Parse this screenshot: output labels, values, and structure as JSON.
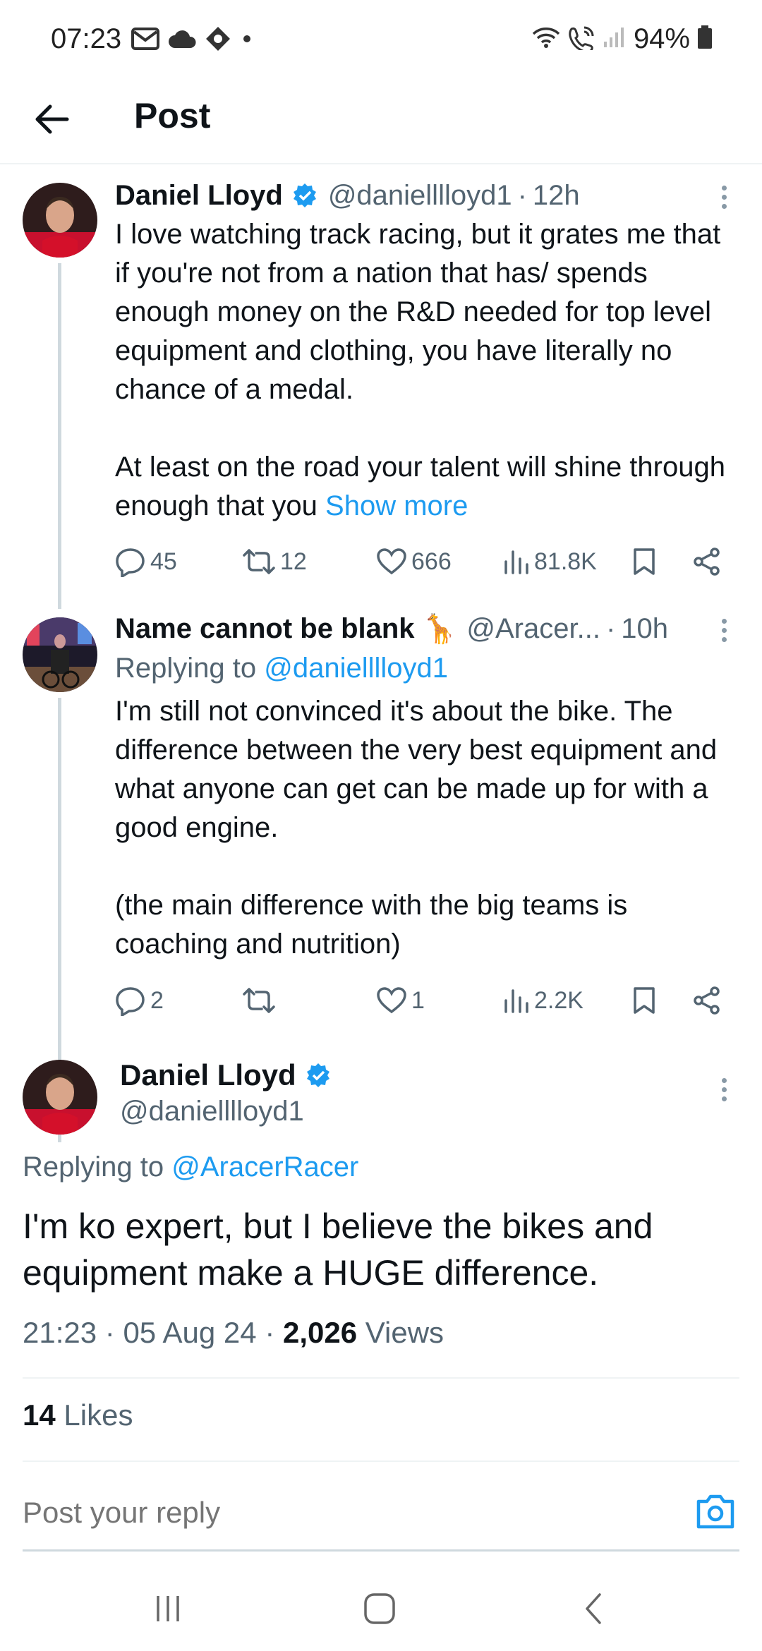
{
  "status_bar": {
    "time": "07:23",
    "battery": "94%",
    "left_icons": [
      "mail-icon",
      "cloud-icon",
      "vpn-icon",
      "notification-dot-icon"
    ],
    "right_icons": [
      "wifi-icon",
      "wifi-calling-icon",
      "signal-icon",
      "battery-icon"
    ]
  },
  "header": {
    "title": "Post",
    "back_icon": "back-arrow-icon"
  },
  "tweets": [
    {
      "name": "Daniel Lloyd",
      "verified": true,
      "handle": "@danielllloyd1",
      "separator": "·",
      "time": "12h",
      "text": "I love watching track racing, but it grates me that if you're not from a nation that has/ spends enough money on the R&D needed for top level equipment and clothing, you have literally no chance of a medal.\n\nAt least on the road your talent will shine through enough that you ",
      "show_more": "Show more",
      "actions": {
        "replies": "45",
        "reposts": "12",
        "likes": "666",
        "views": "81.8K"
      }
    },
    {
      "name": "Name cannot be blank",
      "emoji": "🦒",
      "handle": "@Aracer...",
      "separator": "·",
      "time": "10h",
      "replying_prefix": "Replying to ",
      "replying_to": "@danielllloyd1",
      "text": "I'm still not convinced it's about the bike. The difference between the very best equipment and what anyone can get can be made up for with a good engine.\n\n(the main difference with the big teams is coaching and nutrition)",
      "actions": {
        "replies": "2",
        "reposts": "",
        "likes": "1",
        "views": "2.2K"
      }
    }
  ],
  "focus_tweet": {
    "name": "Daniel Lloyd",
    "verified": true,
    "handle": "@danielllloyd1",
    "replying_prefix": "Replying to ",
    "replying_to": "@AracerRacer",
    "text": "I'm ko expert, but I believe the bikes and equipment make a HUGE difference.",
    "time": "21:23",
    "separator": "·",
    "date": "05 Aug 24",
    "views_count": "2,026",
    "views_label": "Views",
    "likes_count": "14",
    "likes_label": "Likes"
  },
  "reply_box": {
    "placeholder": "Post your reply",
    "camera_icon": "camera-icon"
  },
  "nav_bar": {
    "buttons": [
      "recent-apps-icon",
      "home-icon",
      "back-icon"
    ]
  },
  "colors": {
    "accent": "#1d9bf0",
    "text": "#0f1419",
    "secondary": "#536471",
    "divider": "#eff3f4"
  }
}
